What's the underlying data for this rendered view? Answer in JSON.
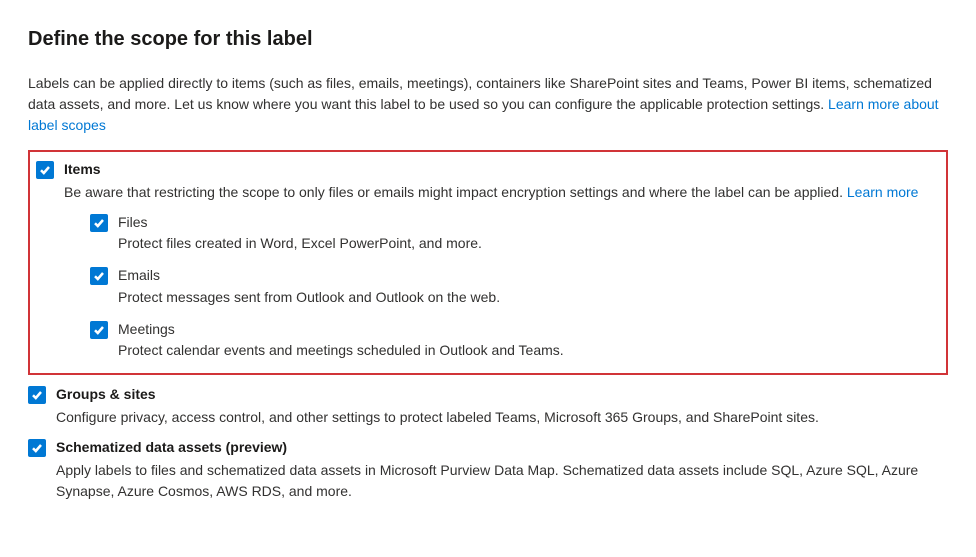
{
  "heading": "Define the scope for this label",
  "intro": "Labels can be applied directly to items (such as files, emails, meetings), containers like SharePoint sites and Teams, Power BI items, schematized data assets, and more. Let us know where you want this label to be used so you can configure the applicable protection settings. ",
  "introLink": "Learn more about label scopes",
  "items": {
    "title": "Items",
    "desc": "Be aware that restricting the scope to only files or emails might impact encryption settings and where the label can be applied. ",
    "learnMore": "Learn more",
    "sub": [
      {
        "title": "Files",
        "desc": "Protect files created in Word, Excel PowerPoint, and more."
      },
      {
        "title": "Emails",
        "desc": "Protect messages sent from Outlook and Outlook on the web."
      },
      {
        "title": "Meetings",
        "desc": "Protect calendar events and meetings scheduled in Outlook and Teams."
      }
    ]
  },
  "groups": {
    "title": "Groups & sites",
    "desc": "Configure privacy, access control, and other settings to protect labeled Teams, Microsoft 365 Groups, and SharePoint sites."
  },
  "schematized": {
    "title": "Schematized data assets (preview)",
    "desc": "Apply labels to files and schematized data assets in Microsoft Purview Data Map. Schematized data assets include SQL, Azure SQL, Azure Synapse, Azure Cosmos, AWS RDS, and more."
  }
}
